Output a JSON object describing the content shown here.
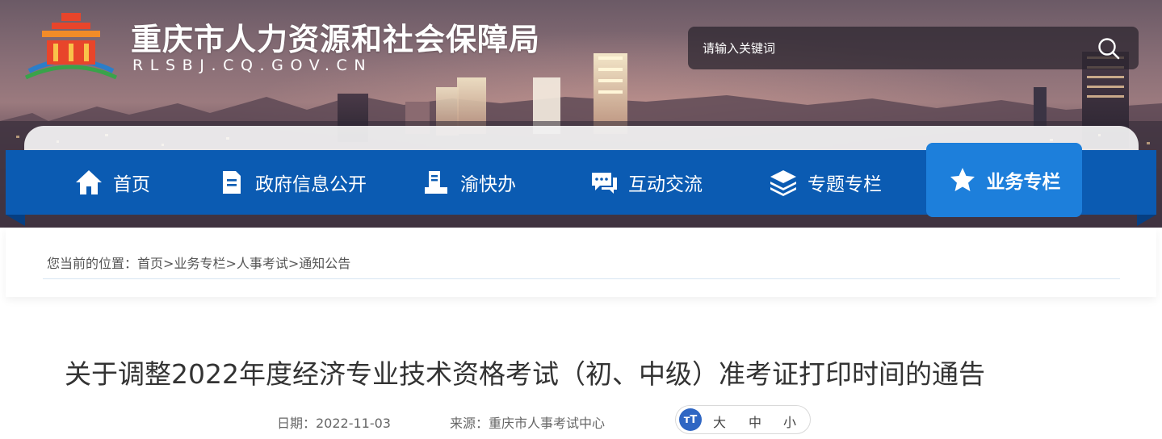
{
  "header": {
    "site_name": "重庆市人力资源和社会保障局",
    "site_domain": "RLSBJ.CQ.GOV.CN",
    "logo_icon": "government-building-logo"
  },
  "search": {
    "placeholder": "请输入关键词",
    "icon": "search-icon"
  },
  "nav": {
    "items": [
      {
        "label": "首页",
        "icon": "home-icon"
      },
      {
        "label": "政府信息公开",
        "icon": "document-icon"
      },
      {
        "label": "渝快办",
        "icon": "service-desk-icon"
      },
      {
        "label": "互动交流",
        "icon": "chat-icon"
      },
      {
        "label": "专题专栏",
        "icon": "layers-icon"
      },
      {
        "label": "业务专栏",
        "icon": "star-icon",
        "active": true
      }
    ],
    "colors": {
      "bar": "#0b5bb2",
      "active": "#1d7fdb"
    }
  },
  "breadcrumb": {
    "prefix": "您当前的位置：",
    "items": [
      "首页",
      "业务专栏",
      "人事考试",
      "通知公告"
    ],
    "separator": ">"
  },
  "article": {
    "title": "关于调整2022年度经济专业技术资格考试（初、中级）准考证打印时间的通告",
    "date": "日期：2022-11-03",
    "source": "来源：重庆市人事考试中心",
    "font_size": {
      "icon": "font-size-icon",
      "icon_text": "тT",
      "large": "大",
      "medium": "中",
      "small": "小"
    }
  }
}
